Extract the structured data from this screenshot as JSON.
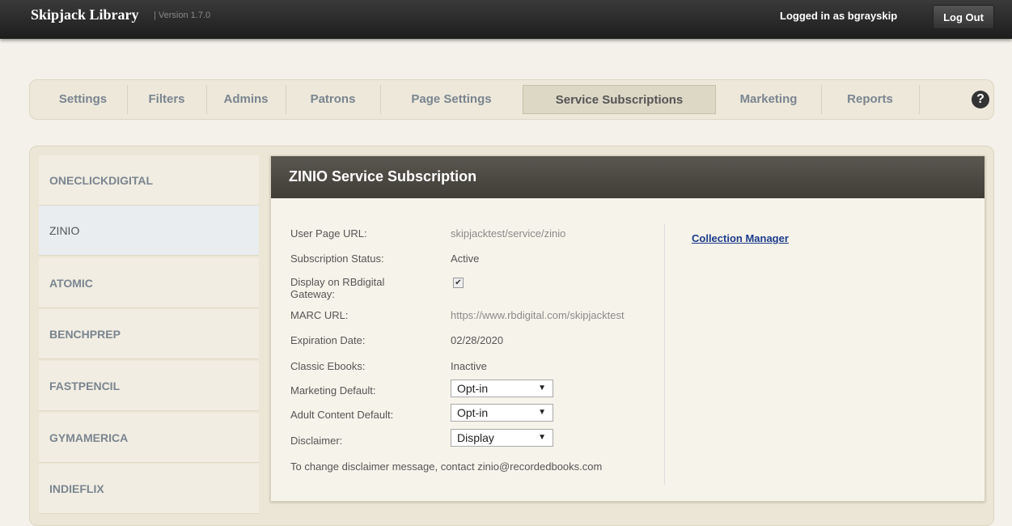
{
  "header": {
    "brand": "Skipjack Library",
    "version": "| Version 1.7.0",
    "logged_in": "Logged in as bgrayskip",
    "logout_label": "Log Out"
  },
  "tabs": [
    {
      "label": "Settings"
    },
    {
      "label": "Filters"
    },
    {
      "label": "Admins"
    },
    {
      "label": "Patrons"
    },
    {
      "label": "Page Settings"
    },
    {
      "label": "Service Subscriptions",
      "active": true
    },
    {
      "label": "Marketing"
    },
    {
      "label": "Reports"
    }
  ],
  "help_icon": "?",
  "sidebar": {
    "items": [
      {
        "label": "ONECLICKDIGITAL"
      },
      {
        "label": "ZINIO",
        "active": true
      },
      {
        "label": "ATOMIC"
      },
      {
        "label": "BENCHPREP"
      },
      {
        "label": "FASTPENCIL"
      },
      {
        "label": "GYMAMERICA"
      },
      {
        "label": "INDIEFLIX"
      }
    ]
  },
  "content": {
    "title": "ZINIO Service Subscription",
    "fields": {
      "user_page_url_label": "User Page URL:",
      "user_page_url_value": "skipjacktest/service/zinio",
      "subscription_status_label": "Subscription Status:",
      "subscription_status_value": "Active",
      "display_gateway_label_1": "Display on RBdigital",
      "display_gateway_label_2": "Gateway:",
      "display_gateway_checked": true,
      "marc_url_label": "MARC URL:",
      "marc_url_value": "https://www.rbdigital.com/skipjacktest",
      "expiration_label": "Expiration Date:",
      "expiration_value": "02/28/2020",
      "classic_ebooks_label": "Classic Ebooks:",
      "classic_ebooks_value": "Inactive",
      "marketing_default_label": "Marketing Default:",
      "marketing_default_value": "Opt-in",
      "adult_content_label": "Adult Content Default:",
      "adult_content_value": "Opt-in",
      "disclaimer_label": "Disclaimer:",
      "disclaimer_value": "Display"
    },
    "note": "To change disclaimer message, contact zinio@recordedbooks.com",
    "collection_manager": "Collection Manager"
  }
}
